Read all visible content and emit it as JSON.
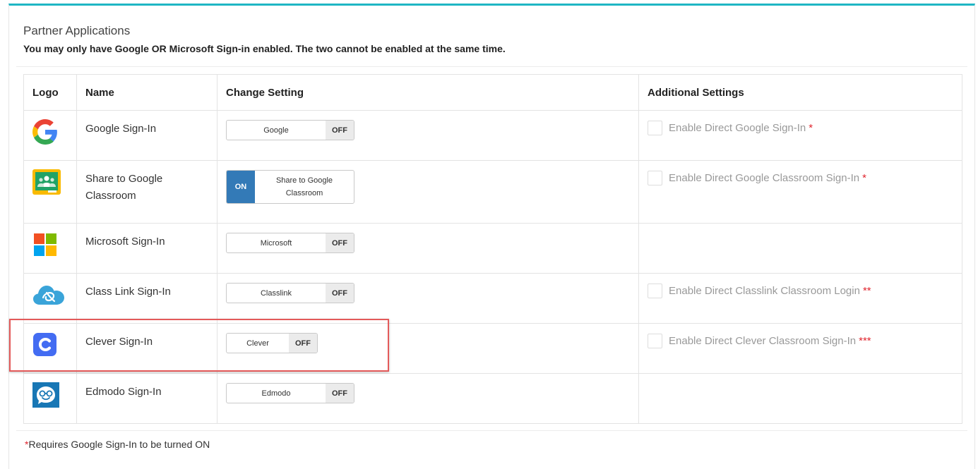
{
  "panel": {
    "title": "Partner Applications",
    "warning": "You may only have Google OR Microsoft Sign-in enabled. The two cannot be enabled at the same time."
  },
  "table": {
    "headers": [
      "Logo",
      "Name",
      "Change Setting",
      "Additional Settings"
    ],
    "rows": [
      {
        "logo_icon": "google-icon",
        "name": "Google Sign-In",
        "toggle_label": "Google",
        "toggle_state": "OFF",
        "additional": "Enable Direct Google Sign-In",
        "additional_marker": "*"
      },
      {
        "logo_icon": "google-classroom-icon",
        "name": "Share to Google Classroom",
        "toggle_label": "Share to Google Classroom",
        "toggle_state": "ON",
        "additional": "Enable Direct Google Classroom Sign-In",
        "additional_marker": "*"
      },
      {
        "logo_icon": "microsoft-icon",
        "name": "Microsoft Sign-In",
        "toggle_label": "Microsoft",
        "toggle_state": "OFF",
        "additional": "",
        "additional_marker": ""
      },
      {
        "logo_icon": "classlink-icon",
        "name": "Class Link Sign-In",
        "toggle_label": "Classlink",
        "toggle_state": "OFF",
        "additional": "Enable Direct Classlink Classroom Login",
        "additional_marker": "**"
      },
      {
        "logo_icon": "clever-icon",
        "name": "Clever Sign-In",
        "toggle_label": "Clever",
        "toggle_state": "OFF",
        "additional": "Enable Direct Clever Classroom Sign-In",
        "additional_marker": "***"
      },
      {
        "logo_icon": "edmodo-icon",
        "name": "Edmodo Sign-In",
        "toggle_label": "Edmodo",
        "toggle_state": "OFF",
        "additional": "",
        "additional_marker": ""
      }
    ]
  },
  "footnote": {
    "marker": "*",
    "text": "Requires Google Sign-In to be turned ON"
  },
  "colors": {
    "accent_top_border": "#1fb6c4",
    "toggle_on": "#337ab7",
    "required_marker": "#e0262f",
    "highlight_box": "#e45a5a"
  }
}
